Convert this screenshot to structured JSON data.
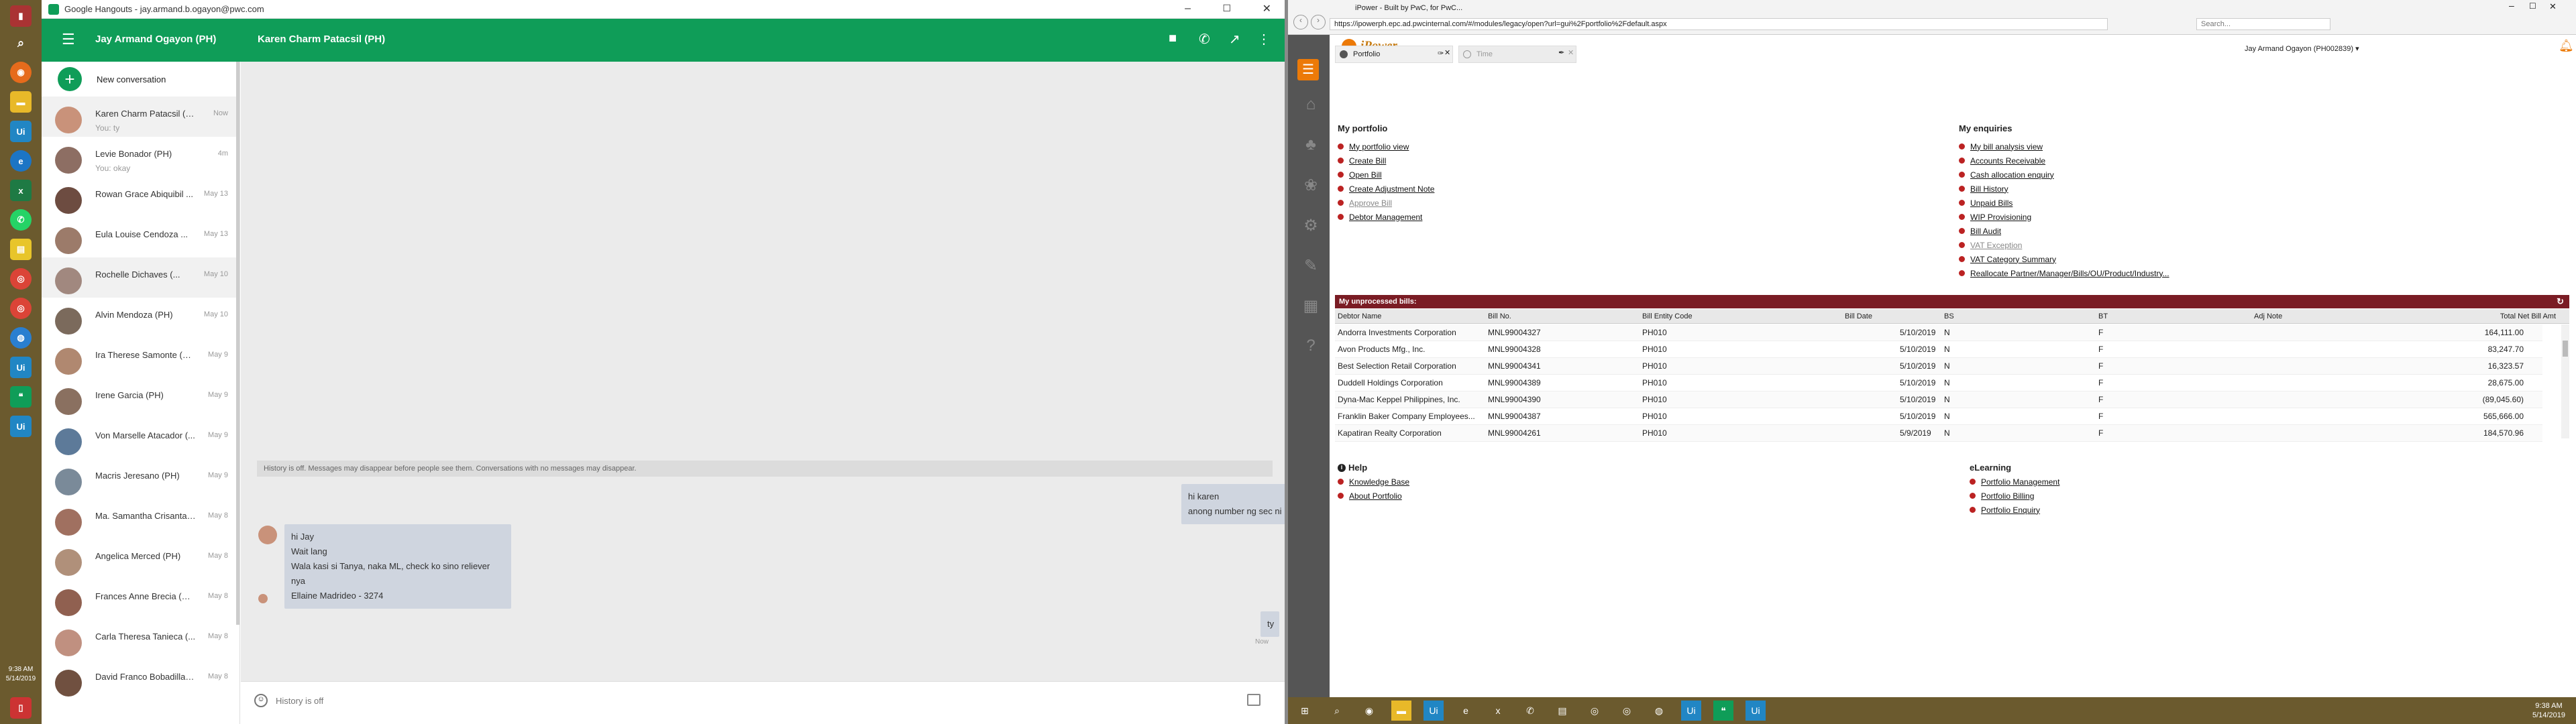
{
  "taskbar_left": {
    "clock_time": "9:38 AM",
    "clock_date": "5/14/2019",
    "icons": [
      "search-icon",
      "firefox-icon",
      "folder-icon",
      "uipath-icon",
      "edge-icon",
      "excel-icon",
      "whatsapp-icon",
      "sticky-notes-icon",
      "chrome-icon",
      "chrome-icon",
      "network-icon",
      "uipath-icon",
      "hangouts-icon",
      "uipath-icon",
      "notepad-icon"
    ]
  },
  "hangouts": {
    "window_title": "Google Hangouts - jay.armand.b.ogayon@pwc.com",
    "user_name": "Jay Armand Ogayon (PH)",
    "chat_title": "Karen Charm Patacsil (PH)",
    "new_conversation": "New conversation",
    "conversations": [
      {
        "name": "Karen Charm Patacsil (PH)",
        "time": "Now",
        "snippet": "You: ty"
      },
      {
        "name": "Levie Bonador (PH)",
        "time": "4m",
        "snippet": "You: okay"
      },
      {
        "name": "Rowan Grace Abiquibil ...",
        "time": "May 13",
        "snippet": ""
      },
      {
        "name": "Eula Louise Cendoza ...",
        "time": "May 13",
        "snippet": ""
      },
      {
        "name": "Rochelle Dichaves (...",
        "time": "May 10",
        "snippet": ""
      },
      {
        "name": "Alvin Mendoza (PH)",
        "time": "May 10",
        "snippet": ""
      },
      {
        "name": "Ira Therese Samonte (PH)",
        "time": "May 9",
        "snippet": ""
      },
      {
        "name": "Irene Garcia (PH)",
        "time": "May 9",
        "snippet": ""
      },
      {
        "name": "Von Marselle Atacador (...",
        "time": "May 9",
        "snippet": ""
      },
      {
        "name": "Macris Jeresano (PH)",
        "time": "May 9",
        "snippet": ""
      },
      {
        "name": "Ma. Samantha Crisanta ...",
        "time": "May 8",
        "snippet": ""
      },
      {
        "name": "Angelica Merced (PH)",
        "time": "May 8",
        "snippet": ""
      },
      {
        "name": "Frances Anne Brecia (PH)",
        "time": "May 8",
        "snippet": ""
      },
      {
        "name": "Carla Theresa Tanieca (...",
        "time": "May 8",
        "snippet": ""
      },
      {
        "name": "David Franco Bobadilla (...",
        "time": "May 8",
        "snippet": ""
      }
    ],
    "history_notice": "History is off. Messages may disappear before people see them. Conversations with no messages may disappear.",
    "msg_out_1": [
      "hi karen",
      "anong number ng sec ni ng"
    ],
    "msg_in_1": [
      "hi Jay",
      "Wait lang",
      "Wala kasi si Tanya, naka ML, check ko sino reliever nya",
      "Ellaine Madrideo - 3274"
    ],
    "msg_out_2": "ty",
    "msg_out_2_time": "Now",
    "input_placeholder": "History is off"
  },
  "ipower": {
    "url": "https://ipowerph.epc.ad.pwcinternal.com/#/modules/legacy/open?url=gui%2Fportfolio%2Fdefault.aspx",
    "search_placeholder": "Search...",
    "tab_label": "iPower - Built by PwC, for PwC...",
    "app_name": "iPower",
    "user": "Jay Armand Ogayon (PH002839) ▾",
    "tab_portfolio": "Portfolio",
    "tab_time": "Time",
    "my_portfolio_title": "My portfolio",
    "my_portfolio": [
      "My portfolio view",
      "Create Bill",
      "Open Bill",
      "Create Adjustment Note",
      "Approve Bill",
      "Debtor Management"
    ],
    "my_enquiries_title": "My enquiries",
    "my_enquiries": [
      "My bill analysis view",
      "Accounts Receivable",
      "Cash allocation enquiry",
      "Bill History",
      "Unpaid Bills",
      "WIP Provisioning",
      "Bill Audit",
      "VAT Exception",
      "VAT Category Summary",
      "Reallocate Partner/Manager/Bills/OU/Product/Industry..."
    ],
    "unprocessed_title": "My unprocessed bills:",
    "columns": [
      "Debtor Name",
      "Bill No.",
      "Bill Entity Code",
      "Bill Date",
      "BS",
      "BT",
      "Adj Note",
      "Total Net Bill Amt"
    ],
    "bills": [
      [
        "Andorra Investments Corporation",
        "MNL99004327",
        "PH010",
        "5/10/2019",
        "N",
        "F",
        "",
        "164,111.00"
      ],
      [
        "Avon Products Mfg., Inc.",
        "MNL99004328",
        "PH010",
        "5/10/2019",
        "N",
        "F",
        "",
        "83,247.70"
      ],
      [
        "Best Selection Retail Corporation",
        "MNL99004341",
        "PH010",
        "5/10/2019",
        "N",
        "F",
        "",
        "16,323.57"
      ],
      [
        "Duddell Holdings Corporation",
        "MNL99004389",
        "PH010",
        "5/10/2019",
        "N",
        "F",
        "",
        "28,675.00"
      ],
      [
        "Dyna-Mac Keppel Philippines, Inc.",
        "MNL99004390",
        "PH010",
        "5/10/2019",
        "N",
        "F",
        "",
        "(89,045.60)"
      ],
      [
        "Franklin Baker Company Employees...",
        "MNL99004387",
        "PH010",
        "5/10/2019",
        "N",
        "F",
        "",
        "565,666.00"
      ],
      [
        "Kapatiran Realty Corporation",
        "MNL99004261",
        "PH010",
        "5/9/2019",
        "N",
        "F",
        "",
        "184,570.96"
      ]
    ],
    "help_title": "Help",
    "help_links": [
      "Knowledge Base",
      "About Portfolio"
    ],
    "elearning_title": "eLearning",
    "elearning_links": [
      "Portfolio Management",
      "Portfolio Billing",
      "Portfolio Enquiry"
    ],
    "clock_time": "9:38 AM",
    "clock_date": "5/14/2019"
  }
}
